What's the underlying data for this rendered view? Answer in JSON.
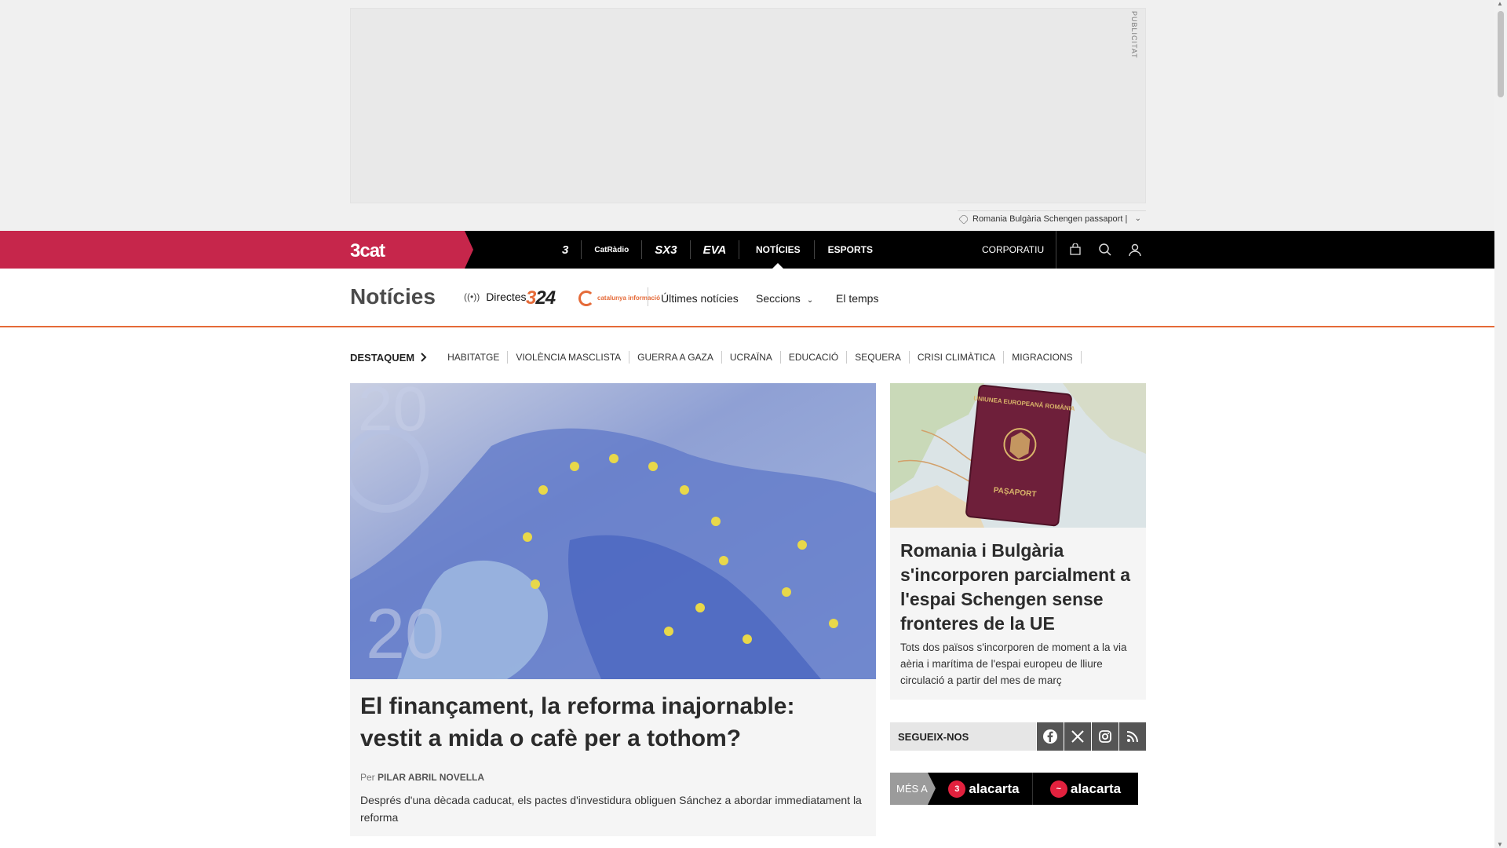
{
  "ad": {
    "publicitat": "PUBLICITAT",
    "tag_label": "Romania Bulgària Schengen passaport |"
  },
  "topbar": {
    "logo": "3cat",
    "brands": [
      "3",
      "CatRàdio",
      "SX3",
      "EVA"
    ],
    "nav": [
      {
        "label": "NOTÍCIES",
        "active": true
      },
      {
        "label": "ESPORTS",
        "active": false
      }
    ],
    "corporatiu": "CORPORATIU"
  },
  "section": {
    "title": "Notícies",
    "directes": "Directes",
    "logo_324": "324",
    "logo_catinfo": "catalunya informació",
    "links": [
      "Últimes notícies",
      "Seccions",
      "El temps"
    ]
  },
  "tags": {
    "lead": "DESTAQUEM",
    "items": [
      "HABITATGE",
      "VIOLÈNCIA MASCLISTA",
      "GUERRA A GAZA",
      "UCRAÏNA",
      "EDUCACIÓ",
      "SEQUERA",
      "CRISI CLIMÀTICA",
      "MIGRACIONS"
    ]
  },
  "main_article": {
    "title": "El finançament, la reforma inajornable: vestit a mida o cafè per a tothom?",
    "by": "Per",
    "author": "PILAR ABRIL NOVELLA",
    "summary": "Després d'una dècada caducat, els pactes d'investidura obliguen Sánchez a abordar immediatament la reforma"
  },
  "side_article": {
    "title": "Romania i Bulgària s'incorporen parcialment a l'espai Schengen sense fronteres de la UE",
    "summary": "Tots dos països s'incorporen de moment a la via aèria i marítima de l'espai europeu de lliure circulació a partir del mes de març",
    "image_text": {
      "passport_header": "UNIUNEA EUROPEANĂ ROMÂNIA",
      "passport_footer": "PAȘAPORT"
    }
  },
  "follow": {
    "label": "SEGUEIX-NOS",
    "icons": [
      "facebook-icon",
      "x-icon",
      "instagram-icon",
      "rss-icon"
    ]
  },
  "alacarta": {
    "mesa": "MÉS A",
    "btn1": "alacarta",
    "btn2": "alacarta"
  },
  "colors": {
    "brand_red": "#c6264b",
    "accent_orange": "#e56a38",
    "topbar": "#000000"
  }
}
